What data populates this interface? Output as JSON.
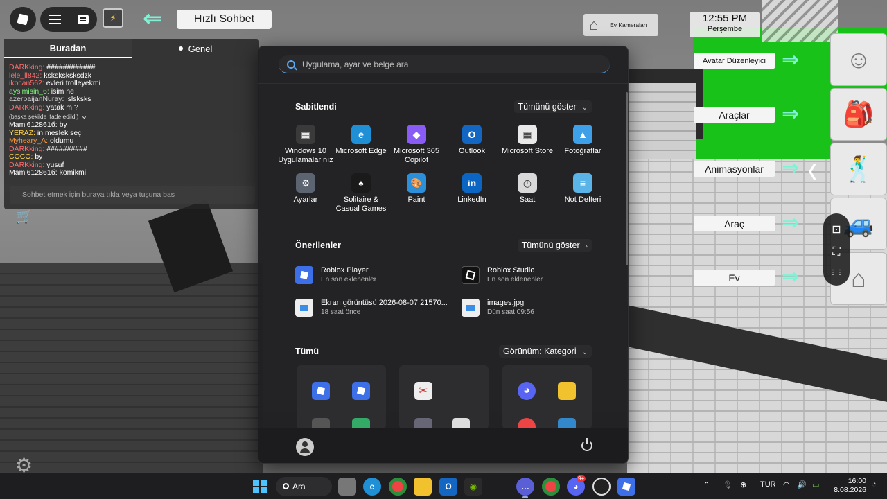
{
  "game": {
    "quick_chat_label": "Hızlı Sohbet",
    "home_camera_label": "Ev Kameraları",
    "clock_time": "12:55 PM",
    "clock_day": "Perşembe",
    "right_panel": {
      "avatar_editor": "Avatar Düzenleyici",
      "tools": "Araçlar",
      "animations": "Animasyonlar",
      "vehicle": "Araç",
      "home": "Ev"
    }
  },
  "chat": {
    "tabs": [
      "Buradan",
      "Genel"
    ],
    "messages": [
      {
        "user": "DARKking:",
        "text": "############",
        "color": "#ff6b6b"
      },
      {
        "user": "lele_ll842:",
        "text": "ksksksksksdzk",
        "color": "#ff6b6b"
      },
      {
        "user": "ikocan562:",
        "text": "evleri trolleyekmi",
        "color": "#ff6b6b"
      },
      {
        "user": "aysimisin_6:",
        "text": "isim ne",
        "color": "#7cf27c"
      },
      {
        "user": "azerbaijanNuray:",
        "text": "lslsksks",
        "color": "#dddddd"
      },
      {
        "user": "DARKking:",
        "text": "yatak mı?",
        "color": "#ff6b6b"
      },
      {
        "user": "(başka şekilde ifade edildi)",
        "text": "",
        "color": "#dddddd",
        "note": true
      },
      {
        "user": "Mami612861б:",
        "text": "by",
        "color": "#ffffff"
      },
      {
        "user": "YERAZ:",
        "text": "in meslek seç",
        "color": "#ffd24d"
      },
      {
        "user": "Myheary_A:",
        "text": "oldumu",
        "color": "#ff9a3c"
      },
      {
        "user": "DARKking:",
        "text": "##########",
        "color": "#ff6b6b"
      },
      {
        "user": "COCO:",
        "text": "by",
        "color": "#ffd24d"
      },
      {
        "user": "DARKking:",
        "text": "yusuf",
        "color": "#ff6b6b"
      },
      {
        "user": "Mami612861б:",
        "text": "komikmi",
        "color": "#ffffff"
      }
    ],
    "input_placeholder": "Sohbet etmek için buraya tıkla veya  tuşuna bas"
  },
  "start_menu": {
    "search_placeholder": "Uygulama, ayar ve belge ara",
    "pinned_title": "Sabitlendi",
    "show_all": "Tümünü göster",
    "pinned": [
      {
        "label": "Windows 10 Uygulamalarınız",
        "icon": "windows-apps-icon",
        "color": "#3a3a3a",
        "glyph": "▦"
      },
      {
        "label": "Microsoft Edge",
        "icon": "edge-icon",
        "color": "#1f8fd6",
        "glyph": "e"
      },
      {
        "label": "Microsoft 365 Copilot",
        "icon": "copilot-icon",
        "color": "#8a5cf6",
        "glyph": "◆"
      },
      {
        "label": "Outlook",
        "icon": "outlook-icon",
        "color": "#1366c2",
        "glyph": "O"
      },
      {
        "label": "Microsoft Store",
        "icon": "store-icon",
        "color": "#e9e9e9",
        "glyph": "▦"
      },
      {
        "label": "Fotoğraflar",
        "icon": "photos-icon",
        "color": "#3ea0e8",
        "glyph": "▲"
      },
      {
        "label": "Ayarlar",
        "icon": "settings-icon",
        "color": "#5b6470",
        "glyph": "⚙"
      },
      {
        "label": "Solitaire & Casual Games",
        "icon": "solitaire-icon",
        "color": "#1a1a1a",
        "glyph": "♠"
      },
      {
        "label": "Paint",
        "icon": "paint-icon",
        "color": "#2b8fd9",
        "glyph": "🎨"
      },
      {
        "label": "LinkedIn",
        "icon": "linkedin-icon",
        "color": "#0a66c2",
        "glyph": "in"
      },
      {
        "label": "Saat",
        "icon": "clock-icon",
        "color": "#d9d9d9",
        "glyph": "◷"
      },
      {
        "label": "Not Defteri",
        "icon": "notepad-icon",
        "color": "#5ab4e8",
        "glyph": "≡"
      }
    ],
    "recommended_title": "Önerilenler",
    "recommended": [
      {
        "title": "Roblox Player",
        "sub": "En son eklenenler",
        "icon": "roblox-player-icon"
      },
      {
        "title": "Roblox Studio",
        "sub": "En son eklenenler",
        "icon": "roblox-studio-icon"
      },
      {
        "title": "Ekran görüntüsü 2026-08-07 21570...",
        "sub": "18 saat önce",
        "icon": "image-file-icon"
      },
      {
        "title": "images.jpg",
        "sub": "Dün saat 09:56",
        "icon": "image-file-icon"
      }
    ],
    "all_title": "Tümü",
    "view_label": "Görünüm: Kategori"
  },
  "taskbar": {
    "search_label": "Ara",
    "language": "TUR",
    "time": "16:00",
    "date": "8.08.2026",
    "notification_badge": "9+"
  },
  "colors": {
    "accent": "#5aa9f4",
    "teal_arrow": "#7ff2d6",
    "grass": "#19c219"
  }
}
